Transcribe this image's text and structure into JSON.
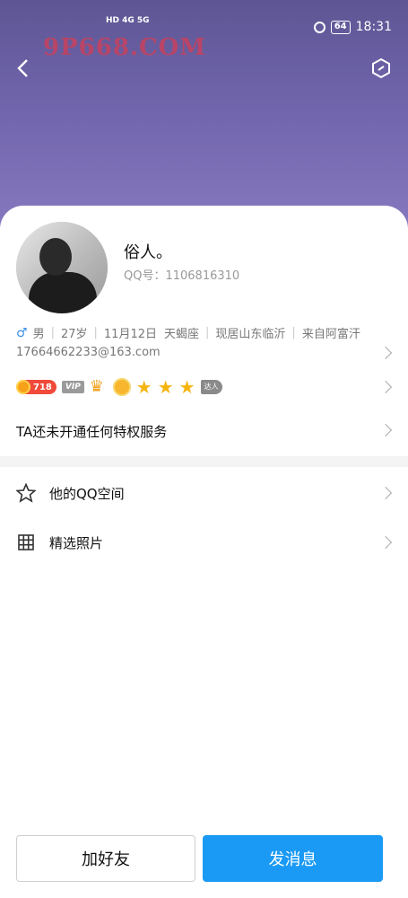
{
  "status_bar": {
    "network_left": "HD 4G 5G",
    "battery": "64",
    "time": "18:31"
  },
  "watermark": "9P668.COM",
  "profile": {
    "nickname": "俗人。",
    "qq_label": "QQ号：1106816310",
    "gender": "男",
    "age": "27岁",
    "birthday": "11月12日",
    "zodiac": "天蝎座",
    "location": "现居山东临沂",
    "hometown": "来自阿富汗",
    "email": "17664662233@163.com"
  },
  "badges": {
    "level": "718",
    "vip": "VIP",
    "daren": "达人"
  },
  "privilege_text": "TA还未开通任何特权服务",
  "menu": [
    {
      "label": "他的QQ空间",
      "icon": "star-outline-icon"
    },
    {
      "label": "精选照片",
      "icon": "grid-icon"
    }
  ],
  "buttons": {
    "add_friend": "加好友",
    "send_message": "发消息"
  },
  "colors": {
    "accent": "#1a9af5",
    "cover": "#7266ae",
    "level_badge": "#f04a3a"
  }
}
